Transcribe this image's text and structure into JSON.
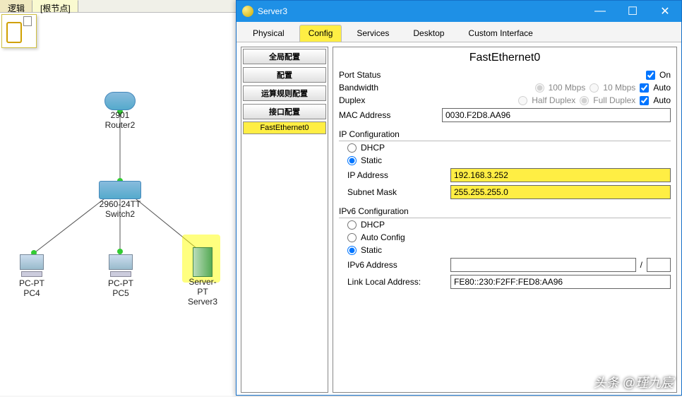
{
  "background": {
    "leftTab": "逻辑",
    "rootTab": "[根节点]",
    "nodes": {
      "router": {
        "label1": "2901",
        "label2": "Router2"
      },
      "switch": {
        "label1": "2960-24TT",
        "label2": "Switch2"
      },
      "pc4": {
        "label1": "PC-PT",
        "label2": "PC4"
      },
      "pc5": {
        "label1": "PC-PT",
        "label2": "PC5"
      },
      "server": {
        "label1": "Server-PT",
        "label2": "Server3"
      }
    }
  },
  "window": {
    "title": "Server3",
    "tabs": [
      "Physical",
      "Config",
      "Services",
      "Desktop",
      "Custom Interface"
    ],
    "activeTab": 1,
    "tree": {
      "headers": [
        "全局配置",
        "配置",
        "运算规则配置",
        "接口配置"
      ],
      "leaf": "FastEthernet0"
    },
    "panel": {
      "title": "FastEthernet0",
      "portStatusLabel": "Port Status",
      "onLabel": "On",
      "bandwidthLabel": "Bandwidth",
      "bw100": "100 Mbps",
      "bw10": "10 Mbps",
      "autoLabel": "Auto",
      "duplexLabel": "Duplex",
      "halfDuplex": "Half Duplex",
      "fullDuplex": "Full Duplex",
      "macLabel": "MAC Address",
      "macValue": "0030.F2D8.AA96",
      "ipConfigHead": "IP Configuration",
      "dhcpLabel": "DHCP",
      "staticLabel": "Static",
      "ipLabel": "IP Address",
      "ipValue": "192.168.3.252",
      "maskLabel": "Subnet Mask",
      "maskValue": "255.255.255.0",
      "ipv6Head": "IPv6 Configuration",
      "autoConfigLabel": "Auto Config",
      "ipv6AddrLabel": "IPv6 Address",
      "ipv6Slash": "/",
      "llLabel": "Link Local Address:",
      "llValue": "FE80::230:F2FF:FED8:AA96"
    }
  },
  "watermark": "头条 @瑾九宸"
}
